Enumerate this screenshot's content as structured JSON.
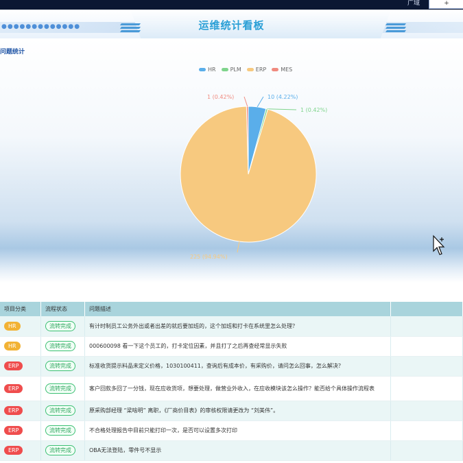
{
  "window": {
    "ctrl_a": "广域",
    "ctrl_b": "+"
  },
  "header": {
    "title": "运维统计看板",
    "dots": "●●●●●●●●●●●●●"
  },
  "panel": {
    "title": "问题统计"
  },
  "chart_data": {
    "type": "pie",
    "legend": [
      "HR",
      "PLM",
      "ERP",
      "MES"
    ],
    "slices": [
      {
        "name": "HR",
        "value": 10,
        "label": "10 (4.22%)",
        "color": "#5aaeea"
      },
      {
        "name": "PLM",
        "value": 1,
        "label": "1 (0.42%)",
        "color": "#7fd48c"
      },
      {
        "name": "ERP",
        "value": 225,
        "label": "225 (94.94%)",
        "color": "#f7c97f"
      },
      {
        "name": "MES",
        "value": 1,
        "label": "1 (0.42%)",
        "color": "#f08a7f"
      }
    ]
  },
  "table": {
    "headers": [
      "项目分类",
      "流程状态",
      "问题描述"
    ],
    "rows": [
      {
        "category": "HR",
        "status": "流转完成",
        "desc": "有计时制员工公务外出或者出差的就后要加班的，这个加班和打卡在系统里怎么处理？"
      },
      {
        "category": "HR",
        "status": "流转完成",
        "desc": "000600098 看一下这个员工的，打卡定位因素，并且打了之后再查经常显示失败"
      },
      {
        "category": "ERP",
        "status": "流转完成",
        "desc": "标准收货提示料品未定义价格，1030100411，查询后有成本价，有采购价，请问怎么回事，怎么解决？"
      },
      {
        "category": "ERP",
        "status": "流转完成",
        "desc": "客户回款多回了一分钱，现在应收货项，想要处理，做营业外收入，在应收模块该怎么操作？能否给个具体操作流程表"
      },
      {
        "category": "ERP",
        "status": "流转完成",
        "desc": "原采购部经理 “梁啥明” 离职，《厂商价目表》的审核权限请更改为 “刘美伟”。"
      },
      {
        "category": "ERP",
        "status": "流转完成",
        "desc": "不合格处理报告中目前只能打印一次，是否可以设置多次打印"
      },
      {
        "category": "ERP",
        "status": "流转完成",
        "desc": "OBA无法登陆，零件号不显示"
      }
    ]
  }
}
